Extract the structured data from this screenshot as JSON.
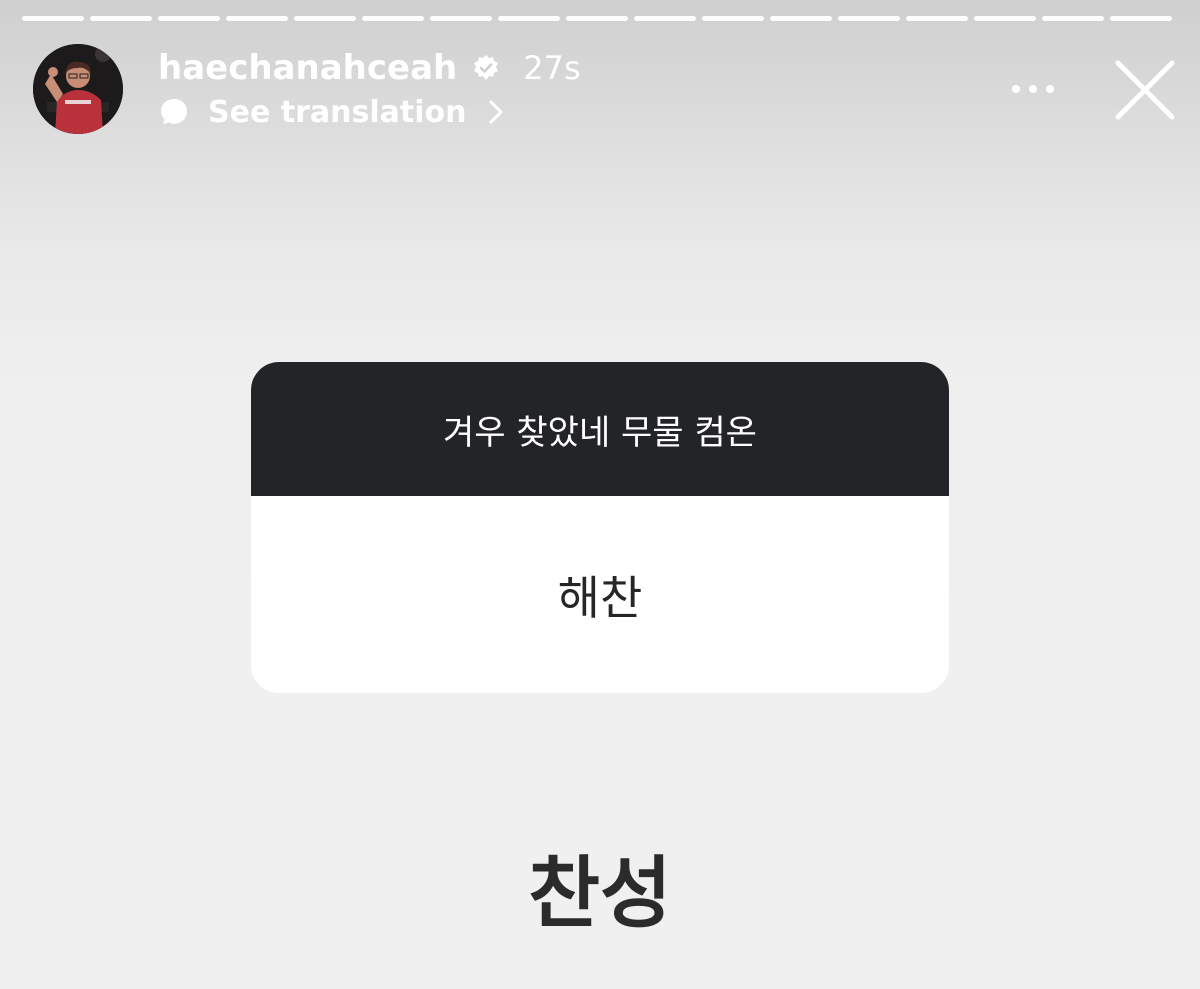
{
  "story": {
    "segments_total": 17,
    "username": "haechanahceah",
    "verified": true,
    "time": "27s",
    "translation_label": "See translation"
  },
  "question_card": {
    "question": "겨우 찾았네 무물 컴온",
    "response": "해찬"
  },
  "answer_text": "찬성",
  "icons": [
    "verified-badge-icon",
    "translation-bubble-icon",
    "chevron-right-icon",
    "more-icon",
    "close-icon"
  ],
  "colors": {
    "card_header": "#222428",
    "card_body": "#ffffff",
    "background": "#f0f0f0"
  }
}
